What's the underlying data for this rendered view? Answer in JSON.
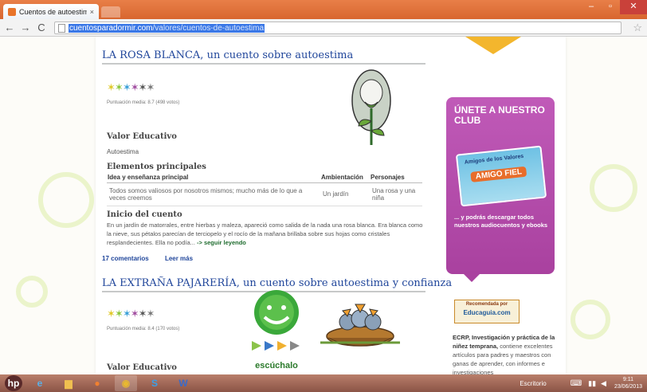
{
  "browser": {
    "tab_title": "Cuentos de autoestima | P",
    "tab_close": "×",
    "url_host": "cuentosparadormir.com",
    "url_path": "/valores/cuentos-de-autoestima",
    "nav": {
      "back": "←",
      "forward": "→",
      "reload": "C"
    },
    "star": "☆",
    "window": {
      "minimize": "–",
      "maximize": "▫",
      "close": "✕"
    }
  },
  "posts": [
    {
      "title": "LA ROSA BLANCA, un cuento sobre autoestima",
      "rating_text": "Puntuación media: 8.7 (498 votos)",
      "valor_label": "Valor Educativo",
      "valor": "Autoestima",
      "elementos_label": "Elementos principales",
      "table_headers": [
        "Idea y enseñanza principal",
        "Ambientación",
        "Personajes"
      ],
      "table_row": [
        "Todos somos valiosos por nosotros mismos; mucho más de lo que a veces creemos",
        "Un jardín",
        "Una rosa y una niña"
      ],
      "inicio_label": "Inicio del cuento",
      "excerpt": "En un jardín de matorrales, entre hierbas y maleza, apareció como salida de la nada una rosa blanca. Era blanca como la nieve, sus pétalos parecían de terciopelo y el rocío de la mañana brillaba sobre sus hojas como cristales resplandecientes. Ella no podía... ",
      "read_link": "-> seguir leyendo",
      "comments": "17 comentarios",
      "read_more": "Leer más"
    },
    {
      "title": "LA EXTRAÑA PAJARERÍA, un cuento sobre autoestima y confianza",
      "rating_text": "Puntuación media: 8.4 (170 votos)",
      "valor_label": "Valor Educativo",
      "listen_label": "escúchalo"
    }
  ],
  "sidebar": {
    "club_title": "ÚNETE A NUESTRO CLUB",
    "card_top": "Amigos de los Valores",
    "card_main": "AMIGO FIEL",
    "club_text": "... y podrás descargar todos nuestros audiocuentos y ebooks",
    "badge_top": "Recomendada por",
    "badge_main": "Educaguia.com",
    "ecrp_bold": "ECRP, Investigación y práctica de la niñez temprana,",
    "ecrp_text": " contiene excelentes artículos para padres y maestros con ganas de aprender, con informes e investigaciones"
  },
  "taskbar": {
    "desktop_label": "Escritorio",
    "time": "9:11",
    "date": "23/06/2013"
  },
  "colors": {
    "title_blue": "#20469b",
    "club_purple": "#b04ca7",
    "link_green": "#1d6b2d"
  }
}
